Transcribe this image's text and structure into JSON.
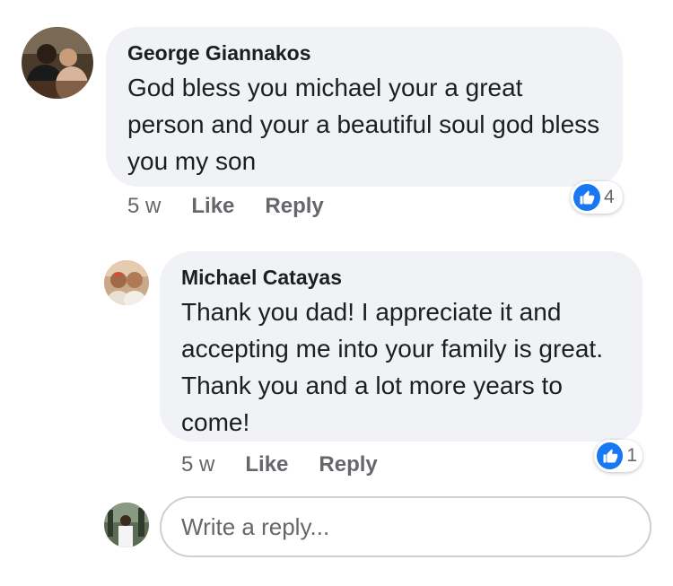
{
  "colors": {
    "bubble_bg": "#f0f2f5",
    "like_blue": "#1877f2",
    "meta_gray": "#65676b",
    "text": "#1c1e21"
  },
  "comments": [
    {
      "author": "George Giannakos",
      "text": "God bless you michael your a great person and your a beautiful soul god bless you my son",
      "age": "5 w",
      "like_label": "Like",
      "reply_label": "Reply",
      "reaction_icon": "thumbs-up-icon",
      "reaction_count": "4"
    },
    {
      "author": "Michael Catayas",
      "text": "Thank you dad! I appreciate it and accepting me into your family is great. Thank you and a lot more years to come!",
      "age": "5 w",
      "like_label": "Like",
      "reply_label": "Reply",
      "reaction_icon": "thumbs-up-icon",
      "reaction_count": "1"
    }
  ],
  "reply_box": {
    "placeholder": "Write a reply..."
  }
}
